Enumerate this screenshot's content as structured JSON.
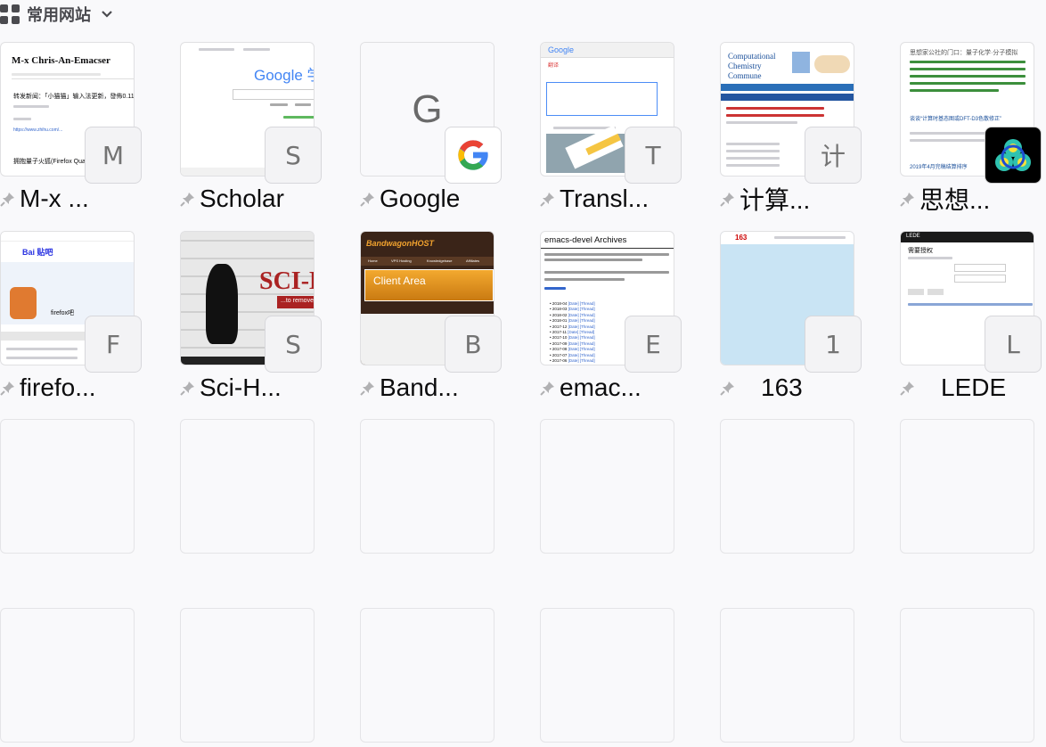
{
  "section": {
    "title": "常用网站",
    "grid_icon": "grid-icon",
    "chevron_icon": "chevron-down-icon"
  },
  "tiles": [
    {
      "label": "M-x ...",
      "badge": "M",
      "preview": {
        "title": "M-x Chris-An-Emacser",
        "text1": "转发新闻：「小猫猫」输入法更新，發佈0.11版",
        "text2": "拥抱量子火狐(Firefox Quan",
        "link": "https://www.zhihu.com/..."
      }
    },
    {
      "label": "Scholar",
      "badge": "S",
      "preview": {
        "logo": "Google 学术"
      }
    },
    {
      "label": "Google",
      "badge": "G",
      "preview": {
        "letter": "G"
      }
    },
    {
      "label": "Transl...",
      "badge": "T",
      "preview": {
        "logo": "Google",
        "sub": "翻译"
      }
    },
    {
      "label": "计算...",
      "badge": "计",
      "preview": {
        "logo": "Computational Chemistry Commune"
      }
    },
    {
      "label": "思想...",
      "badge": "",
      "preview": {
        "title": "思想家公社的门口：量子化学·分子模拟",
        "post": "谈谈“计算时基态图或DFT-D3色散修正”",
        "date": "2019年4月完稿结算排序"
      }
    },
    {
      "label": "firefo...",
      "badge": "F",
      "preview": {
        "logo": "Bai 贴吧",
        "name": "firefox吧"
      }
    },
    {
      "label": "Sci-H...",
      "badge": "S",
      "preview": {
        "text": "SCI-H",
        "sub": "...to remove all"
      }
    },
    {
      "label": "Band...",
      "badge": "B",
      "preview": {
        "logo": "BandwagonHOST",
        "area": "Client Area",
        "tabs": [
          "Home",
          "VPS Hosting",
          "Knowledgebase",
          "Affiliates"
        ]
      }
    },
    {
      "label": "emac...",
      "badge": "E",
      "preview": {
        "title": "emacs-devel Archives",
        "months": [
          "2018-04",
          "2018-03",
          "2018-02",
          "2018-01",
          "2017-12",
          "2017-11",
          "2017-10",
          "2017-09",
          "2017-08",
          "2017-07",
          "2017-06"
        ]
      }
    },
    {
      "label": "163",
      "badge": "1",
      "preview": {
        "logo": "163"
      }
    },
    {
      "label": "LEDE",
      "badge": "L",
      "preview": {
        "title": "LEDE",
        "heading": "需要授权"
      }
    }
  ],
  "empty_rows": 2
}
